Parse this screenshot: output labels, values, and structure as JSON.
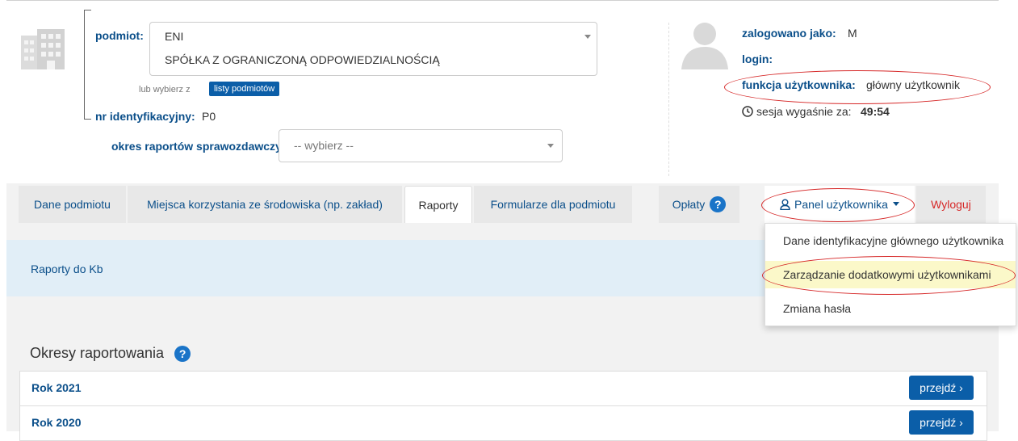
{
  "entity": {
    "label": "podmiot:",
    "name_line1": "ENI",
    "name_line2": "SPÓŁKA Z OGRANICZONĄ ODPOWIEDZIALNOŚCIĄ",
    "or_choose": "lub wybierz z",
    "list_button": "listy podmiotów",
    "id_label": "nr identyfikacyjny:",
    "id_value": "P0"
  },
  "period": {
    "label": "okres raportów sprawozdawczych:",
    "placeholder": "-- wybierz --"
  },
  "user": {
    "logged_label": "zalogowano jako:",
    "logged_value": "M",
    "login_label": "login:",
    "function_label": "funkcja użytkownika:",
    "function_value": "główny użytkownik",
    "session_text": "sesja wygaśnie za:",
    "session_time": "49:54"
  },
  "tabs": [
    {
      "label": "Dane podmiotu"
    },
    {
      "label": "Miejsca korzystania ze środowiska (np. zakład)"
    },
    {
      "label": "Raporty"
    },
    {
      "label": "Formularze dla podmiotu"
    },
    {
      "label": "Opłaty"
    },
    {
      "label": "Panel użytkownika"
    },
    {
      "label": "Wyloguj"
    }
  ],
  "band": {
    "link": "Raporty do Kb"
  },
  "periods": {
    "title": "Okresy raportowania",
    "rows": [
      {
        "year": "Rok 2021",
        "go": "przejdź ›"
      },
      {
        "year": "Rok 2020",
        "go": "przejdź ›"
      }
    ]
  },
  "dropdown": {
    "items": [
      {
        "label": "Dane identyfikacyjne głównego użytkownika"
      },
      {
        "label": "Zarządzanie dodatkowymi użytkownikami"
      },
      {
        "label": "Zmiana hasła"
      }
    ]
  },
  "colors": {
    "accent": "#0b4f8a",
    "button": "#0b5ea8",
    "annotation": "#d62828",
    "highlight": "#fbf8c9"
  }
}
